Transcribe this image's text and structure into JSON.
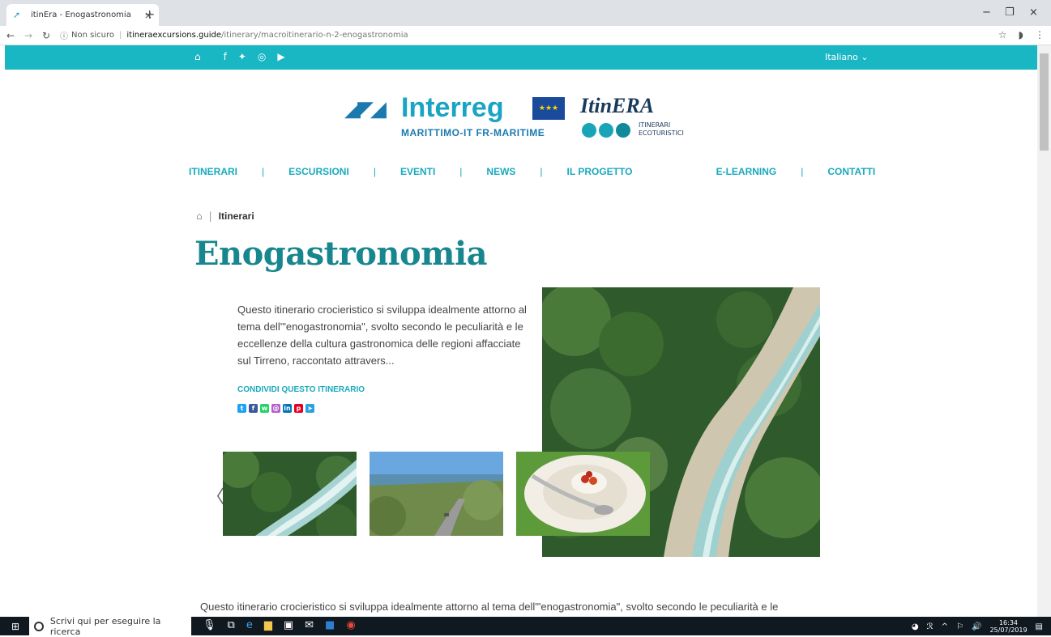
{
  "browser": {
    "tab_title": "itinEra - Enogastronomia",
    "tab_close": "×",
    "new_tab": "+",
    "security_label": "Non sicuro",
    "url_host": "itineraexcursions.guide",
    "url_path": "/itinerary/macroitinerario-n-2-enogastronomia",
    "win_minimize": "−",
    "win_restore": "❐",
    "win_close": "×"
  },
  "topbar": {
    "language": "Italiano ⌄"
  },
  "logos": {
    "interreg_word": "Interreg",
    "interreg_sub": "MARITTIMO-IT FR-MARITIME",
    "itinera_name": "ItinERA",
    "itinera_sub_1": "ITINERARI",
    "itinera_sub_2": "ECOTURISTICI"
  },
  "nav": [
    "ITINERARI",
    "ESCURSIONI",
    "EVENTI",
    "NEWS",
    "IL PROGETTO",
    "E-LEARNING",
    "CONTATTI"
  ],
  "breadcrumb": {
    "current": "Itinerari"
  },
  "page": {
    "title": "Enogastronomia",
    "intro": "Questo itinerario crocieristico si sviluppa idealmente attorno al tema dell'\"enogastronomia\", svolto secondo le peculiarità e le eccellenze della cultura gastronomica delle regioni affacciate sul Tirreno, raccontato attravers...",
    "share_label": "CONDIVIDI QUESTO ITINERARIO",
    "bottom_text": "Questo itinerario crocieristico si sviluppa idealmente attorno al tema dell'\"enogastronomia\", svolto secondo le peculiarità e le"
  },
  "share_icons": [
    {
      "name": "twitter-icon",
      "color": "#1da1f2"
    },
    {
      "name": "facebook-icon",
      "color": "#3b5998"
    },
    {
      "name": "whatsapp-icon",
      "color": "#25d366"
    },
    {
      "name": "email-icon",
      "color": "#b45fc9"
    },
    {
      "name": "linkedin-icon",
      "color": "#0077b5"
    },
    {
      "name": "pinterest-icon",
      "color": "#e60023"
    },
    {
      "name": "telegram-icon",
      "color": "#2aa3de"
    }
  ],
  "taskbar": {
    "search_placeholder": "Scrivi qui per eseguire la ricerca",
    "time": "16:34",
    "date": "25/07/2019"
  },
  "colors": {
    "accent": "#19b6c4",
    "title": "#17868e"
  }
}
